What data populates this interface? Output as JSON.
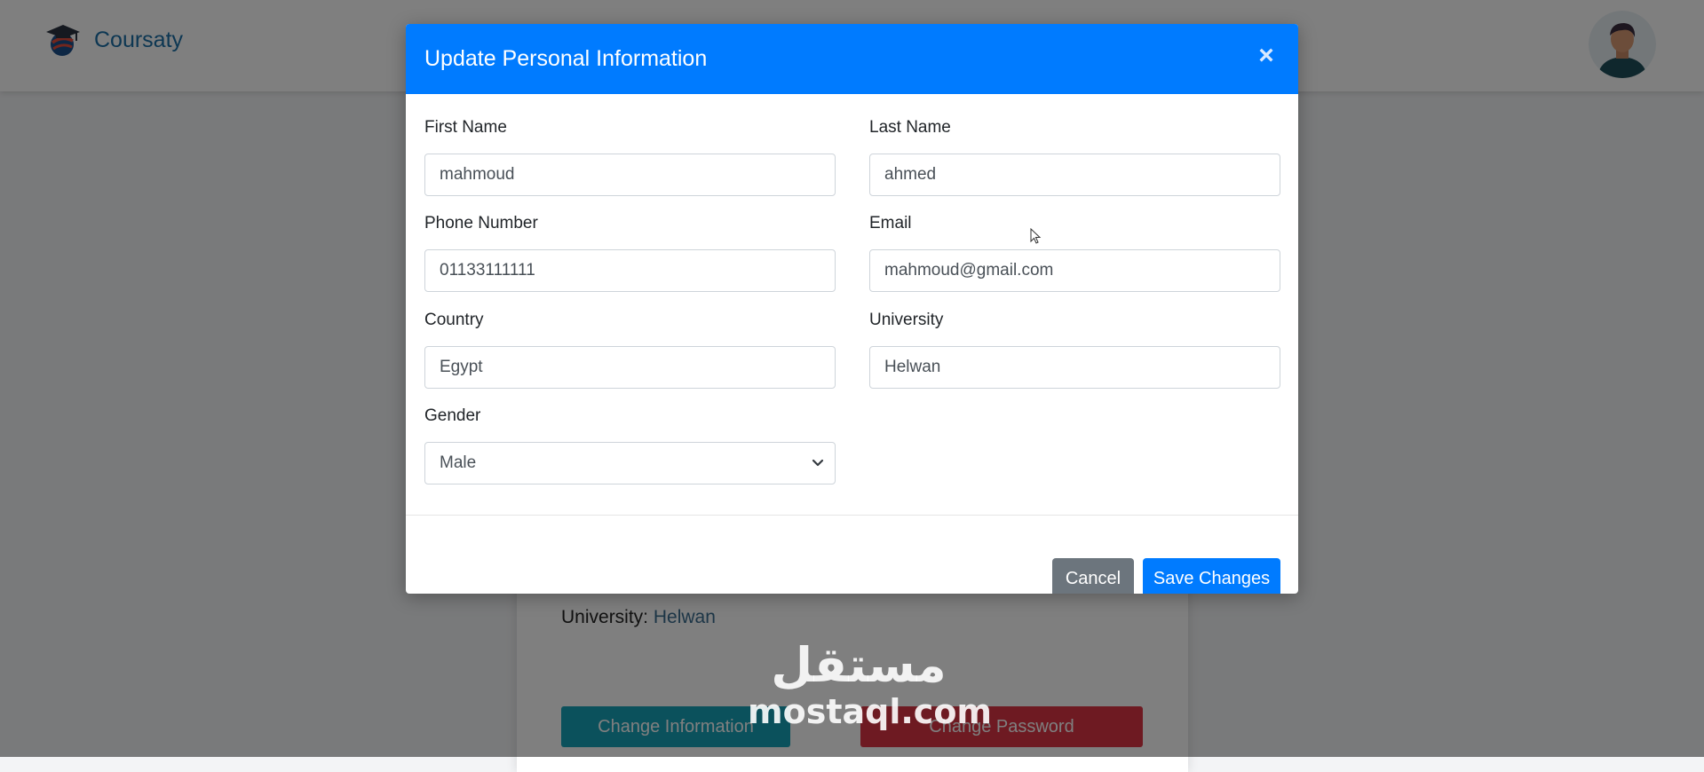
{
  "brand": {
    "name": "Coursaty"
  },
  "profile_card": {
    "university_label": "University:",
    "university_value": "Helwan",
    "change_information_label": "Change Information",
    "change_password_label": "Change Password"
  },
  "watermark": {
    "arabic": "مستقل",
    "latin": "mostaql.com"
  },
  "modal": {
    "title": "Update Personal Information",
    "close_symbol": "×",
    "fields": {
      "first_name": {
        "label": "First Name",
        "value": "mahmoud"
      },
      "last_name": {
        "label": "Last Name",
        "value": "ahmed"
      },
      "phone": {
        "label": "Phone Number",
        "value": "01133111111"
      },
      "email": {
        "label": "Email",
        "value": "mahmoud@gmail.com"
      },
      "country": {
        "label": "Country",
        "value": "Egypt"
      },
      "university": {
        "label": "University",
        "value": "Helwan"
      },
      "gender": {
        "label": "Gender",
        "value": "Male"
      }
    },
    "cancel_label": "Cancel",
    "save_label": "Save Changes"
  },
  "colors": {
    "primary": "#007bff",
    "secondary": "#6c757d",
    "info": "#17a2b8",
    "danger": "#dc3545",
    "brand_text": "#1b6fa6"
  },
  "icons": {
    "logo": "graduation-cap-globe-icon",
    "avatar": "user-avatar",
    "close": "close-icon",
    "dropdown": "chevron-down-icon",
    "cursor": "mouse-cursor-icon"
  }
}
